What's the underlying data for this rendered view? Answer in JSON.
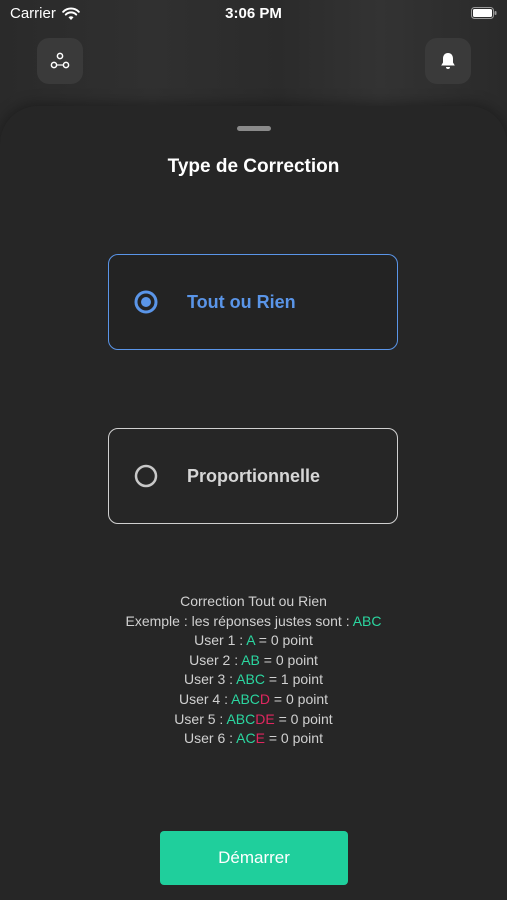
{
  "status_bar": {
    "carrier": "Carrier",
    "time": "3:06 PM"
  },
  "top_bar": {
    "left_icon": "network-icon",
    "right_icon": "bell-icon"
  },
  "sheet": {
    "title": "Type de Correction",
    "options": [
      {
        "label": "Tout ou Rien",
        "selected": true
      },
      {
        "label": "Proportionnelle",
        "selected": false
      }
    ],
    "explanation": {
      "heading": "Correction Tout ou Rien",
      "example_prefix": "Exemple : les réponses justes sont : ",
      "correct_answers": "ABC",
      "users": [
        {
          "prefix": "User 1 : ",
          "correct": "A",
          "wrong": "",
          "suffix": " = 0 point"
        },
        {
          "prefix": "User 2 : ",
          "correct": "AB",
          "wrong": "",
          "suffix": " = 0 point"
        },
        {
          "prefix": "User 3 : ",
          "correct": "ABC",
          "wrong": "",
          "suffix": " = 1 point"
        },
        {
          "prefix": "User 4 : ",
          "correct": "ABC",
          "wrong": "D",
          "suffix": " = 0 point"
        },
        {
          "prefix": "User 5 : ",
          "correct": "ABC",
          "wrong": "DE",
          "suffix": " = 0 point"
        },
        {
          "prefix": "User 6 : ",
          "correct": "AC",
          "wrong": "E",
          "suffix": " = 0 point"
        }
      ]
    },
    "start_button": "Démarrer"
  },
  "colors": {
    "accent_blue": "#5a95e8",
    "correct_green": "#2bd6a0",
    "wrong_red": "#e0265f",
    "button_green": "#1fcf9c"
  }
}
